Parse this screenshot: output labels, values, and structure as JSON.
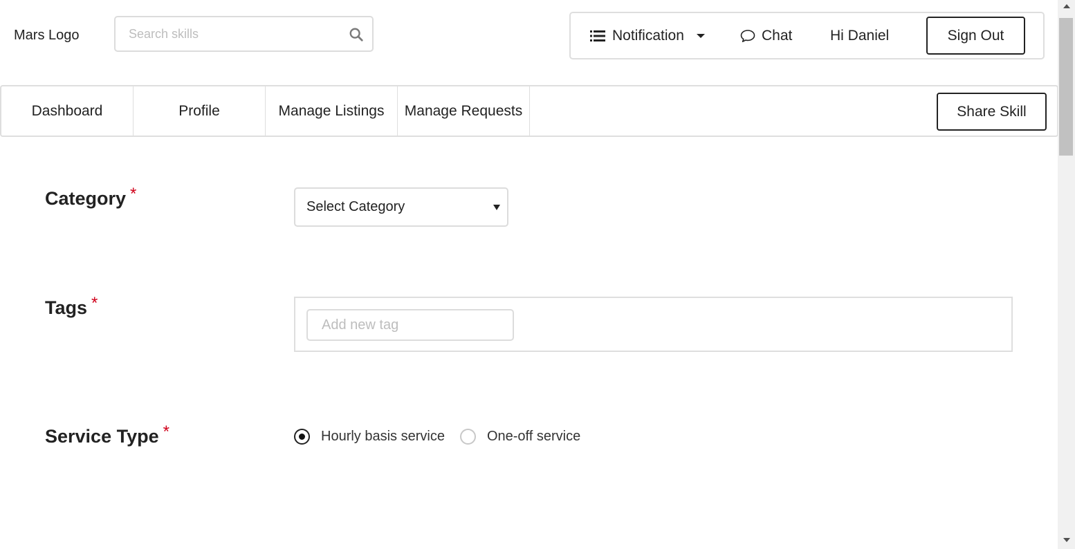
{
  "header": {
    "logo_text": "Mars Logo",
    "search": {
      "placeholder": "Search skills",
      "icon": "search-icon"
    },
    "notification_label": "Notification",
    "chat_label": "Chat",
    "greeting": "Hi Daniel",
    "signout_label": "Sign Out"
  },
  "nav": {
    "tabs": [
      {
        "label": "Dashboard"
      },
      {
        "label": "Profile"
      },
      {
        "label": "Manage Listings"
      },
      {
        "label": "Manage Requests"
      }
    ],
    "share_label": "Share Skill"
  },
  "form": {
    "required_marker": "*",
    "category": {
      "label": "Category",
      "selected": "Select Category"
    },
    "tags": {
      "label": "Tags",
      "placeholder": "Add new tag"
    },
    "service_type": {
      "label": "Service Type",
      "options": [
        {
          "label": "Hourly basis service",
          "checked": true
        },
        {
          "label": "One-off service",
          "checked": false
        }
      ]
    }
  },
  "colors": {
    "required": "#d0021b",
    "border": "#dedede",
    "text": "#222222",
    "placeholder": "#bdbdbd"
  }
}
